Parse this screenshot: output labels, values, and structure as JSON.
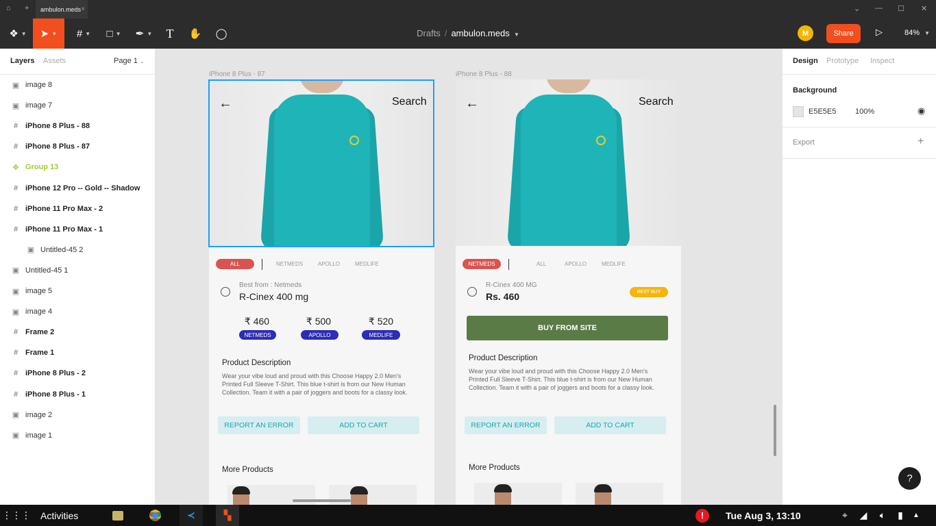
{
  "browser": {
    "tab_title": "ambulon.meds"
  },
  "toolbar": {
    "breadcrumb_root": "Drafts",
    "breadcrumb_sep": "/",
    "file_name": "ambulon.meds",
    "avatar_initial": "M",
    "share_label": "Share",
    "zoom": "84%"
  },
  "left_panel": {
    "tabs": [
      "Layers",
      "Assets"
    ],
    "page_selector": "Page 1",
    "layers": [
      {
        "name": "image 8",
        "kind": "image"
      },
      {
        "name": "image 7",
        "kind": "image"
      },
      {
        "name": "iPhone 8 Plus - 88",
        "kind": "frame"
      },
      {
        "name": "iPhone 8 Plus - 87",
        "kind": "frame"
      },
      {
        "name": "Group 13",
        "kind": "group"
      },
      {
        "name": "iPhone 12 Pro -- Gold -- Shadow",
        "kind": "frame"
      },
      {
        "name": "iPhone 11 Pro Max - 2",
        "kind": "frame"
      },
      {
        "name": "iPhone 11 Pro Max - 1",
        "kind": "frame"
      },
      {
        "name": "Untitled-45 2",
        "kind": "image-indent"
      },
      {
        "name": "Untitled-45 1",
        "kind": "image"
      },
      {
        "name": "image 5",
        "kind": "image"
      },
      {
        "name": "image 4",
        "kind": "image"
      },
      {
        "name": "Frame 2",
        "kind": "frame"
      },
      {
        "name": "Frame 1",
        "kind": "frame"
      },
      {
        "name": "iPhone 8 Plus - 2",
        "kind": "frame"
      },
      {
        "name": "iPhone 8 Plus - 1",
        "kind": "frame"
      },
      {
        "name": "image 2",
        "kind": "image"
      },
      {
        "name": "image 1",
        "kind": "image"
      }
    ]
  },
  "right_panel": {
    "tabs": [
      "Design",
      "Prototype",
      "Inspect"
    ],
    "background_label": "Background",
    "bg_hex": "E5E5E5",
    "bg_opacity": "100%",
    "export_label": "Export",
    "plus": "+"
  },
  "canvas": {
    "frame1": {
      "label": "iPhone 8 Plus - 87",
      "search": "Search",
      "filters": [
        "ALL",
        "NETMEDS",
        "APOLLO",
        "MEDLIFE"
      ],
      "best_from": "Best from : Netmeds",
      "product": "R-Cinex 400 mg",
      "prices": [
        {
          "price": "₹ 460",
          "store": "NETMEDS"
        },
        {
          "price": "₹ 500",
          "store": "APOLLO"
        },
        {
          "price": "₹ 520",
          "store": "MEDLIFE"
        }
      ],
      "desc_title": "Product Description",
      "desc_text": "Wear your vibe loud and proud with this Choose Happy 2.0 Men's Printed Full Sleeve T-Shirt. This blue t-shirt is from our New Human Collection. Team it with a pair of joggers and boots for a classy look.",
      "report_btn": "REPORT AN ERROR",
      "cart_btn": "ADD TO CART",
      "more_title": "More Products"
    },
    "frame2": {
      "label": "iPhone 8 Plus - 88",
      "search": "Search",
      "filters": [
        "NETMEDS",
        "ALL",
        "APOLLO",
        "MEDLIFE"
      ],
      "subtitle": "R-Cinex 400 MG",
      "price": "Rs. 460",
      "best_buy": "BEST BUY",
      "buy_btn": "BUY FROM SITE",
      "desc_title": "Product Description",
      "desc_text": "Wear your vibe loud and proud with this Choose Happy 2.0 Men's Printed Full Sleeve T-Shirt. This blue t-shirt is from our New Human Collection. Team it with a pair of joggers and boots for a classy look.",
      "report_btn": "REPORT AN ERROR",
      "cart_btn": "ADD TO CART",
      "more_title": "More Products"
    }
  },
  "help": "?",
  "taskbar": {
    "activities": "Activities",
    "clock": "Tue Aug  3, 13:10",
    "alert": "!"
  },
  "colors": {
    "accent": "#f24e1e",
    "selection": "#18a0fb",
    "group": "#a3c93a",
    "teal": "#1fb4b8",
    "buy_green": "#5a7a46"
  }
}
